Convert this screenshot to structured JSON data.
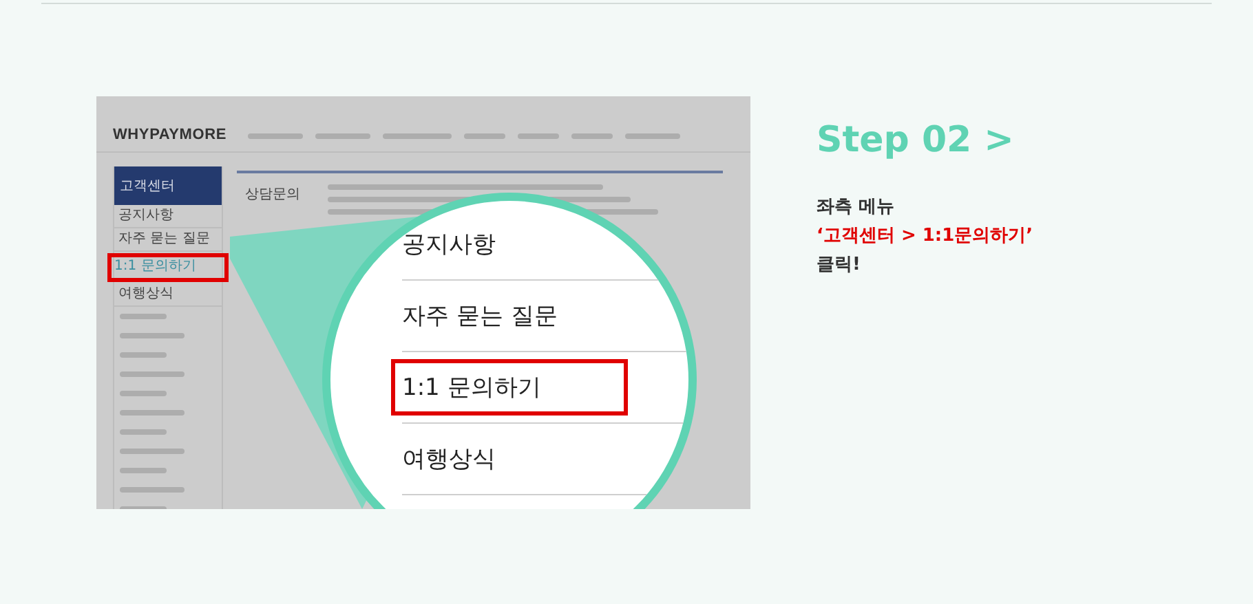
{
  "tutorial_image": {
    "logo": "WHYPAYMORE",
    "sidebar": {
      "title": "고객센터",
      "items": [
        {
          "label": "공지사항",
          "selected": false
        },
        {
          "label": "자주 묻는 질문",
          "selected": false
        },
        {
          "label": "1:1 문의하기",
          "selected": true
        },
        {
          "label": "여행상식",
          "selected": false
        }
      ]
    },
    "content": {
      "label": "상담문의"
    },
    "magnifier": {
      "items": [
        {
          "label": "공지사항",
          "selected": false
        },
        {
          "label": "자주 묻는 질문",
          "selected": false
        },
        {
          "label": "1:1 문의하기",
          "selected": true
        },
        {
          "label": "여행상식",
          "selected": false
        }
      ]
    }
  },
  "step": {
    "title": "Step 02 >",
    "lines": [
      {
        "text": "좌측 메뉴",
        "kind": "plain"
      },
      {
        "text": "‘고객센터 > 1:1문의하기’",
        "kind": "highlight"
      },
      {
        "text": "클릭!",
        "kind": "plain"
      }
    ]
  }
}
